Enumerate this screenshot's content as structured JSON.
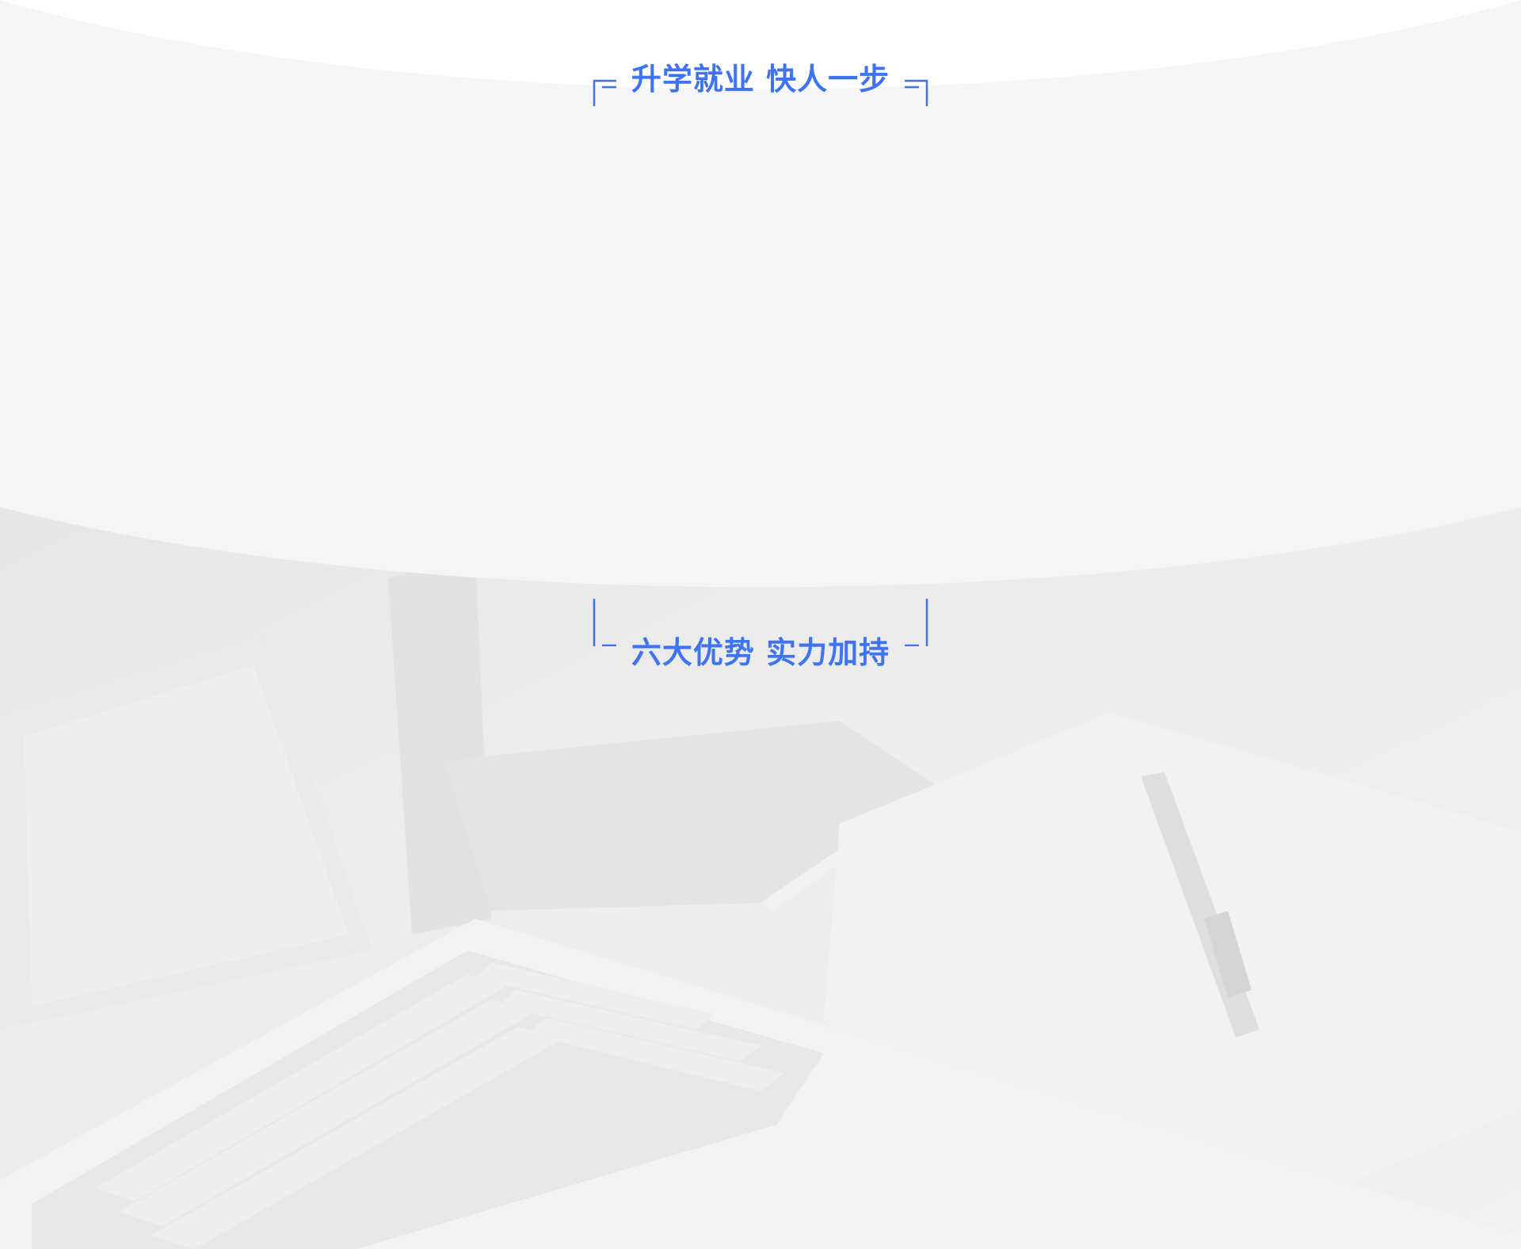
{
  "colors": {
    "accent": "#3e73f4",
    "band_background": "#f5f5f7",
    "top_background": "#ffffff",
    "photo_background": "#ebebeb"
  },
  "sections": {
    "top": {
      "title": "升学就业 快人一步"
    },
    "bottom": {
      "title": "六大优势 实力加持"
    }
  },
  "background": {
    "photo_subject": "laptop-notebook-pen-desk-photo"
  }
}
